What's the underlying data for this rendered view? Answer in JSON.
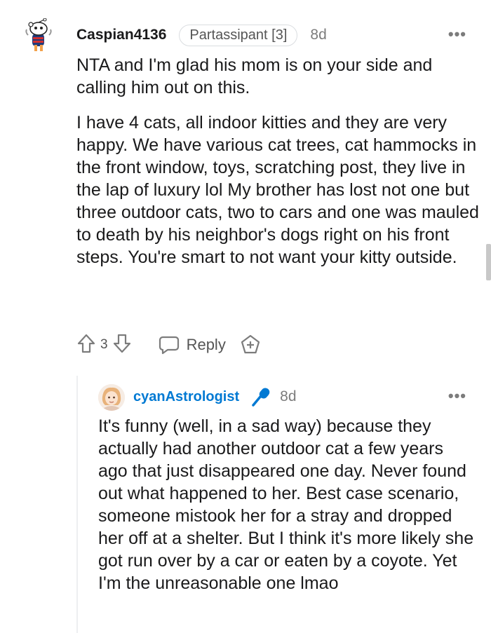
{
  "comment1": {
    "username": "Caspian4136",
    "flair": "Partassipant [3]",
    "time": "8d",
    "more": "•••",
    "paragraphs": [
      "NTA and I'm glad his mom is on your side and calling him out on this.",
      "I have 4 cats, all indoor kitties and they are very happy. We have various cat trees, cat hammocks in the front window, toys, scratching post, they live in the lap of luxury lol My brother has lost not one but three outdoor cats, two to cars and one was mauled to death by his neighbor's dogs right on his front steps. You're smart to not want your kitty outside."
    ],
    "score": "3",
    "reply_label": "Reply"
  },
  "comment2": {
    "username": "cyanAstrologist",
    "time": "8d",
    "more": "•••",
    "paragraphs": [
      "It's funny (well, in a sad way) because they actually had another outdoor cat a few years ago that just disappeared one day. Never found out what happened to her. Best case scenario, someone mistook her for a stray and dropped her off at a shelter. But I think it's more likely she got run over by a car or eaten by a coyote. Yet I'm the unreasonable one lmao"
    ]
  },
  "colors": {
    "link_blue": "#0079d3",
    "mic_blue": "#0079d3",
    "meta_gray": "#7c7c7c",
    "text": "#1a1a1b"
  },
  "icons": [
    "snoo-avatar",
    "upvote-icon",
    "downvote-icon",
    "reply-icon",
    "award-icon",
    "mic-icon",
    "more-icon"
  ]
}
